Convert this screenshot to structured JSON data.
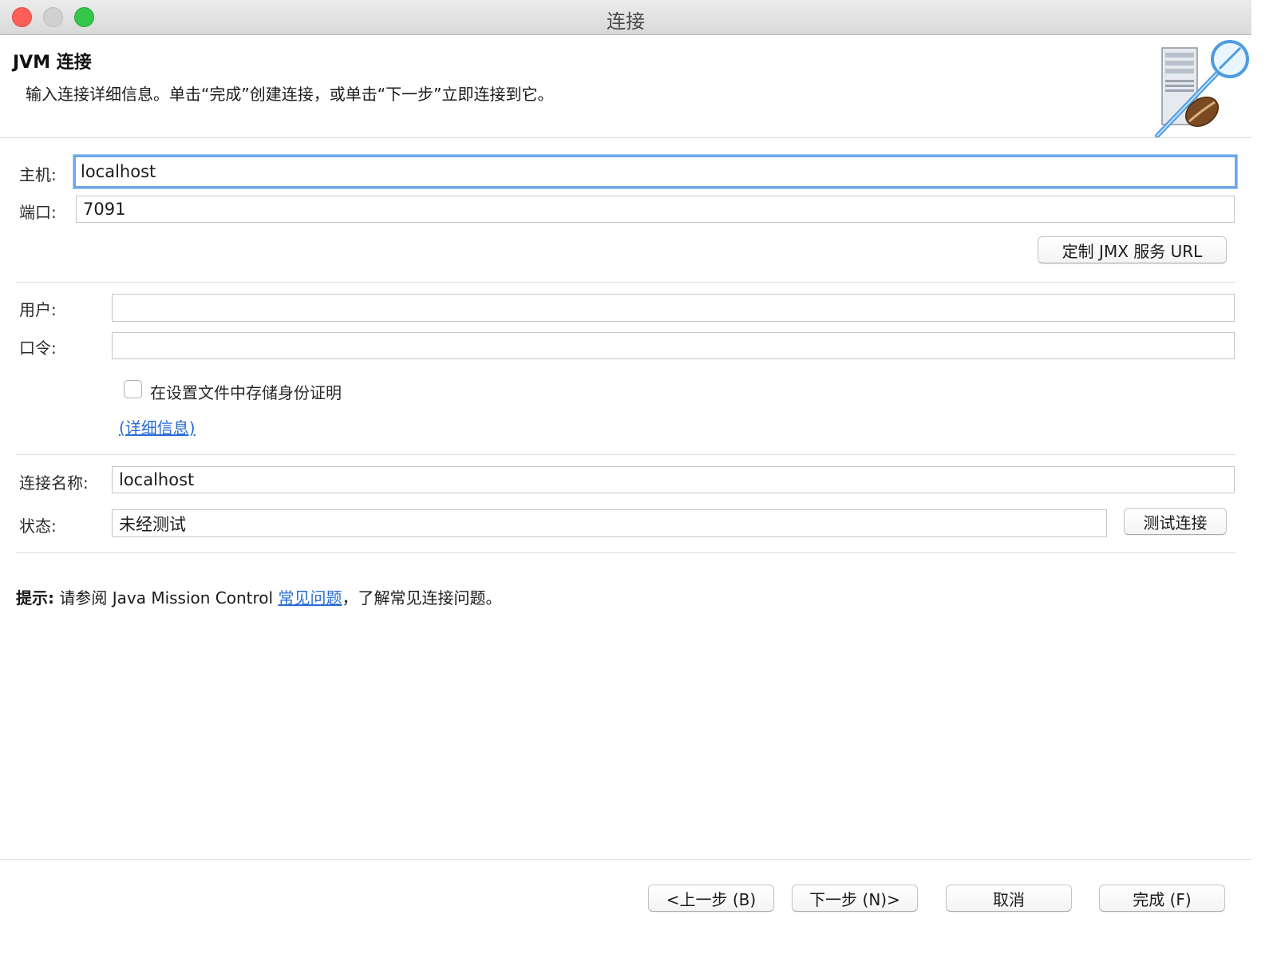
{
  "window": {
    "title": "连接"
  },
  "header": {
    "title": "JVM 连接",
    "description": "输入连接详细信息。单击“完成”创建连接，或单击“下一步”立即连接到它。",
    "icon": "jvm-connection-wizard-icon"
  },
  "connection": {
    "host_label": "主机:",
    "host_value": "localhost",
    "port_label": "端口:",
    "port_value": "7091",
    "custom_jmx_button": "定制 JMX 服务 URL"
  },
  "credentials": {
    "user_label": "用户:",
    "user_value": "",
    "password_label": "口令:",
    "password_value": "",
    "store_checkbox_label": "在设置文件中存储身份证明",
    "store_checked": false,
    "details_link": "(详细信息)"
  },
  "connection_info": {
    "name_label": "连接名称:",
    "name_value": "localhost",
    "status_label": "状态:",
    "status_value": "未经测试",
    "test_button": "测试连接"
  },
  "hint": {
    "label": "提示:",
    "text_before": " 请参阅 Java Mission Control ",
    "link": "常见问题",
    "text_after": "，了解常见连接问题。"
  },
  "footer": {
    "back_button": "<上一步 (B)",
    "next_button": "下一步 (N)>",
    "cancel_button": "取消",
    "finish_button": "完成 (F)"
  },
  "colors": {
    "focus_ring": "#6fa7e8",
    "link": "#2a6bd4",
    "close": "#fc5f57",
    "zoom": "#34c749"
  }
}
